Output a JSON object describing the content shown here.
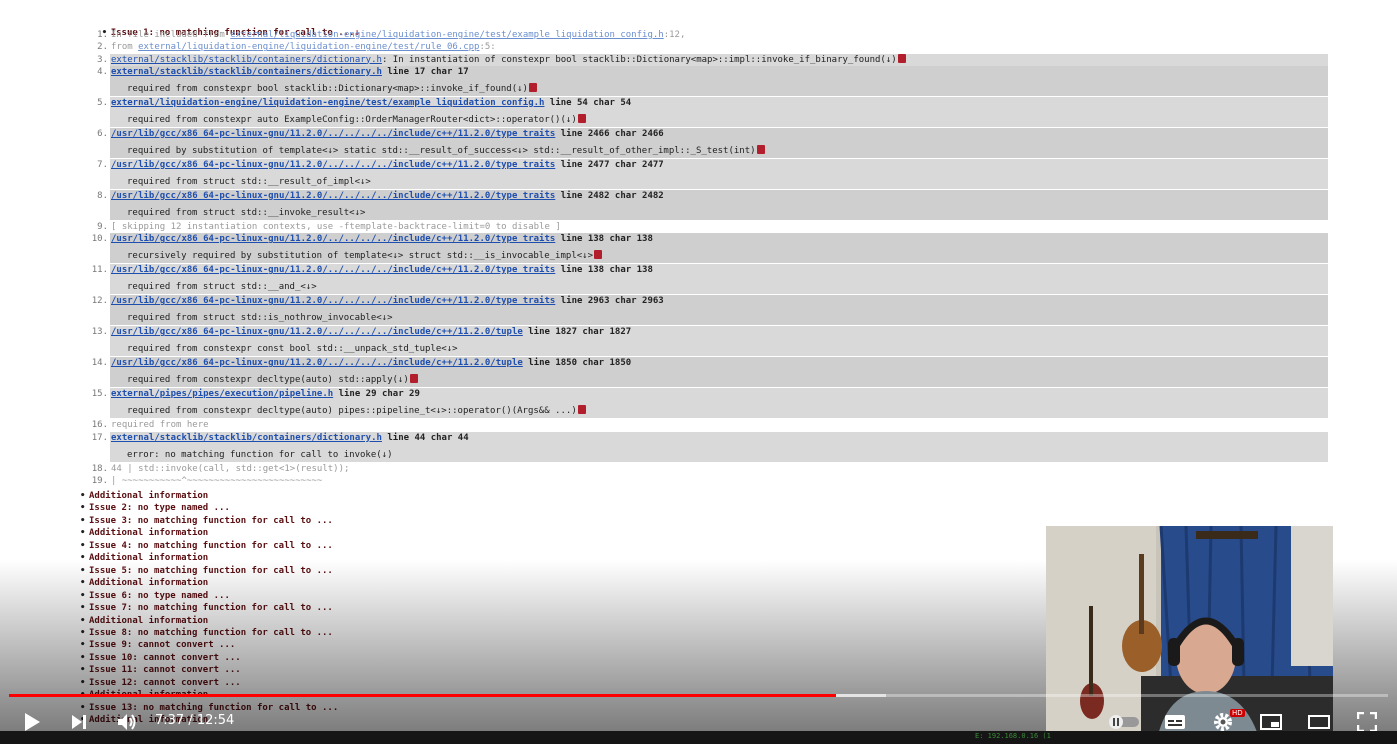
{
  "issue1": {
    "title": "Issue 1: no matching function for call to ...",
    "lines": [
      {
        "n": "1.",
        "pre": "In file included from ",
        "file": "external/liquidation-engine/liquidation-engine/test/example_liquidation_config.h",
        "post": ":12,"
      },
      {
        "n": "2.",
        "pre": "from ",
        "file": "external/liquidation-engine/liquidation-engine/test/rule_06.cpp",
        "post": ":5:"
      },
      {
        "n": "3.",
        "file": "external/stacklib/stacklib/containers/dictionary.h",
        "post": ": In instantiation of constexpr bool stacklib::Dictionary<map>::impl::invoke_if_binary_found(↓)"
      },
      {
        "n": "4.",
        "file": "external/stacklib/stacklib/containers/dictionary.h",
        "pos": " line 17 char 17",
        "req": "required from constexpr bool stacklib::Dictionary<map>::invoke_if_found(↓)"
      },
      {
        "n": "5.",
        "file": "external/liquidation-engine/liquidation-engine/test/example_liquidation_config.h",
        "pos": " line 54 char 54",
        "req": "required from constexpr auto ExampleConfig::OrderManagerRouter<dict>::operator()(↓)"
      },
      {
        "n": "6.",
        "file": "/usr/lib/gcc/x86_64-pc-linux-gnu/11.2.0/../../../../include/c++/11.2.0/type_traits",
        "pos": " line 2466 char 2466",
        "req": "required by substitution of template<↓> static std::__result_of_success<↓> std::__result_of_other_impl::_S_test(int)"
      },
      {
        "n": "7.",
        "file": "/usr/lib/gcc/x86_64-pc-linux-gnu/11.2.0/../../../../include/c++/11.2.0/type_traits",
        "pos": " line 2477 char 2477",
        "req": "required from struct std::__result_of_impl<↓>"
      },
      {
        "n": "8.",
        "file": "/usr/lib/gcc/x86_64-pc-linux-gnu/11.2.0/../../../../include/c++/11.2.0/type_traits",
        "pos": " line 2482 char 2482",
        "req": "required from struct std::__invoke_result<↓>"
      },
      {
        "n": "9.",
        "skip": "[ skipping 12 instantiation contexts, use -ftemplate-backtrace-limit=0 to disable ]"
      },
      {
        "n": "10.",
        "file": "/usr/lib/gcc/x86_64-pc-linux-gnu/11.2.0/../../../../include/c++/11.2.0/type_traits",
        "pos": " line 138 char 138",
        "req": "recursively required by substitution of template<↓> struct std::__is_invocable_impl<↓>"
      },
      {
        "n": "11.",
        "file": "/usr/lib/gcc/x86_64-pc-linux-gnu/11.2.0/../../../../include/c++/11.2.0/type_traits",
        "pos": " line 138 char 138",
        "req": "required from struct std::__and_<↓>"
      },
      {
        "n": "12.",
        "file": "/usr/lib/gcc/x86_64-pc-linux-gnu/11.2.0/../../../../include/c++/11.2.0/type_traits",
        "pos": " line 2963 char 2963",
        "req": "required from struct std::is_nothrow_invocable<↓>"
      },
      {
        "n": "13.",
        "file": "/usr/lib/gcc/x86_64-pc-linux-gnu/11.2.0/../../../../include/c++/11.2.0/tuple",
        "pos": " line 1827 char 1827",
        "req": "required from constexpr const bool std::__unpack_std_tuple<↓>"
      },
      {
        "n": "14.",
        "file": "/usr/lib/gcc/x86_64-pc-linux-gnu/11.2.0/../../../../include/c++/11.2.0/tuple",
        "pos": " line 1850 char 1850",
        "req": "required from constexpr decltype(auto) std::apply(↓)"
      },
      {
        "n": "15.",
        "file": "external/pipes/pipes/execution/pipeline.h",
        "pos": " line 29 char 29",
        "req": "required from constexpr decltype(auto) pipes::pipeline_t<↓>::operator()(Args&& ...)"
      },
      {
        "n": "16.",
        "plain": "required from here"
      },
      {
        "n": "17.",
        "file": "external/stacklib/stacklib/containers/dictionary.h",
        "pos": " line 44 char 44",
        "req": "error: no matching function for call to invoke(↓)"
      },
      {
        "n": "18.",
        "plain": "44 | std::invoke(call, std::get<1>(result));"
      },
      {
        "n": "19.",
        "plain": "| ~~~~~~~~~~~^~~~~~~~~~~~~~~~~~~~~~~~~~"
      }
    ]
  },
  "issues": [
    "Additional information",
    "Issue 2: no type named ...",
    "Issue 3: no matching function for call to ...",
    "Additional information",
    "Issue 4: no matching function for call to ...",
    "Additional information",
    "Issue 5: no matching function for call to ...",
    "Additional information",
    "Issue 6: no type named ...",
    "Issue 7: no matching function for call to ...",
    "Additional information",
    "Issue 8: no matching function for call to ...",
    "Issue 9: cannot convert ...",
    "Issue 10: cannot convert ...",
    "Issue 11: cannot convert ...",
    "Issue 12: cannot convert ...",
    "Additional information",
    "Issue 13: no matching function for call to ...",
    "Additional information"
  ],
  "player": {
    "time": "7:37 / 12:54",
    "played_fraction": 0.6,
    "buffered_fraction": 0.636,
    "hd_badge": "HD",
    "colors": {
      "progress": "#ff0000",
      "accent": "#b21e2b",
      "link": "#1f4fae"
    }
  },
  "taskbar": {
    "status": "E: 192.168.0.16 (1"
  }
}
